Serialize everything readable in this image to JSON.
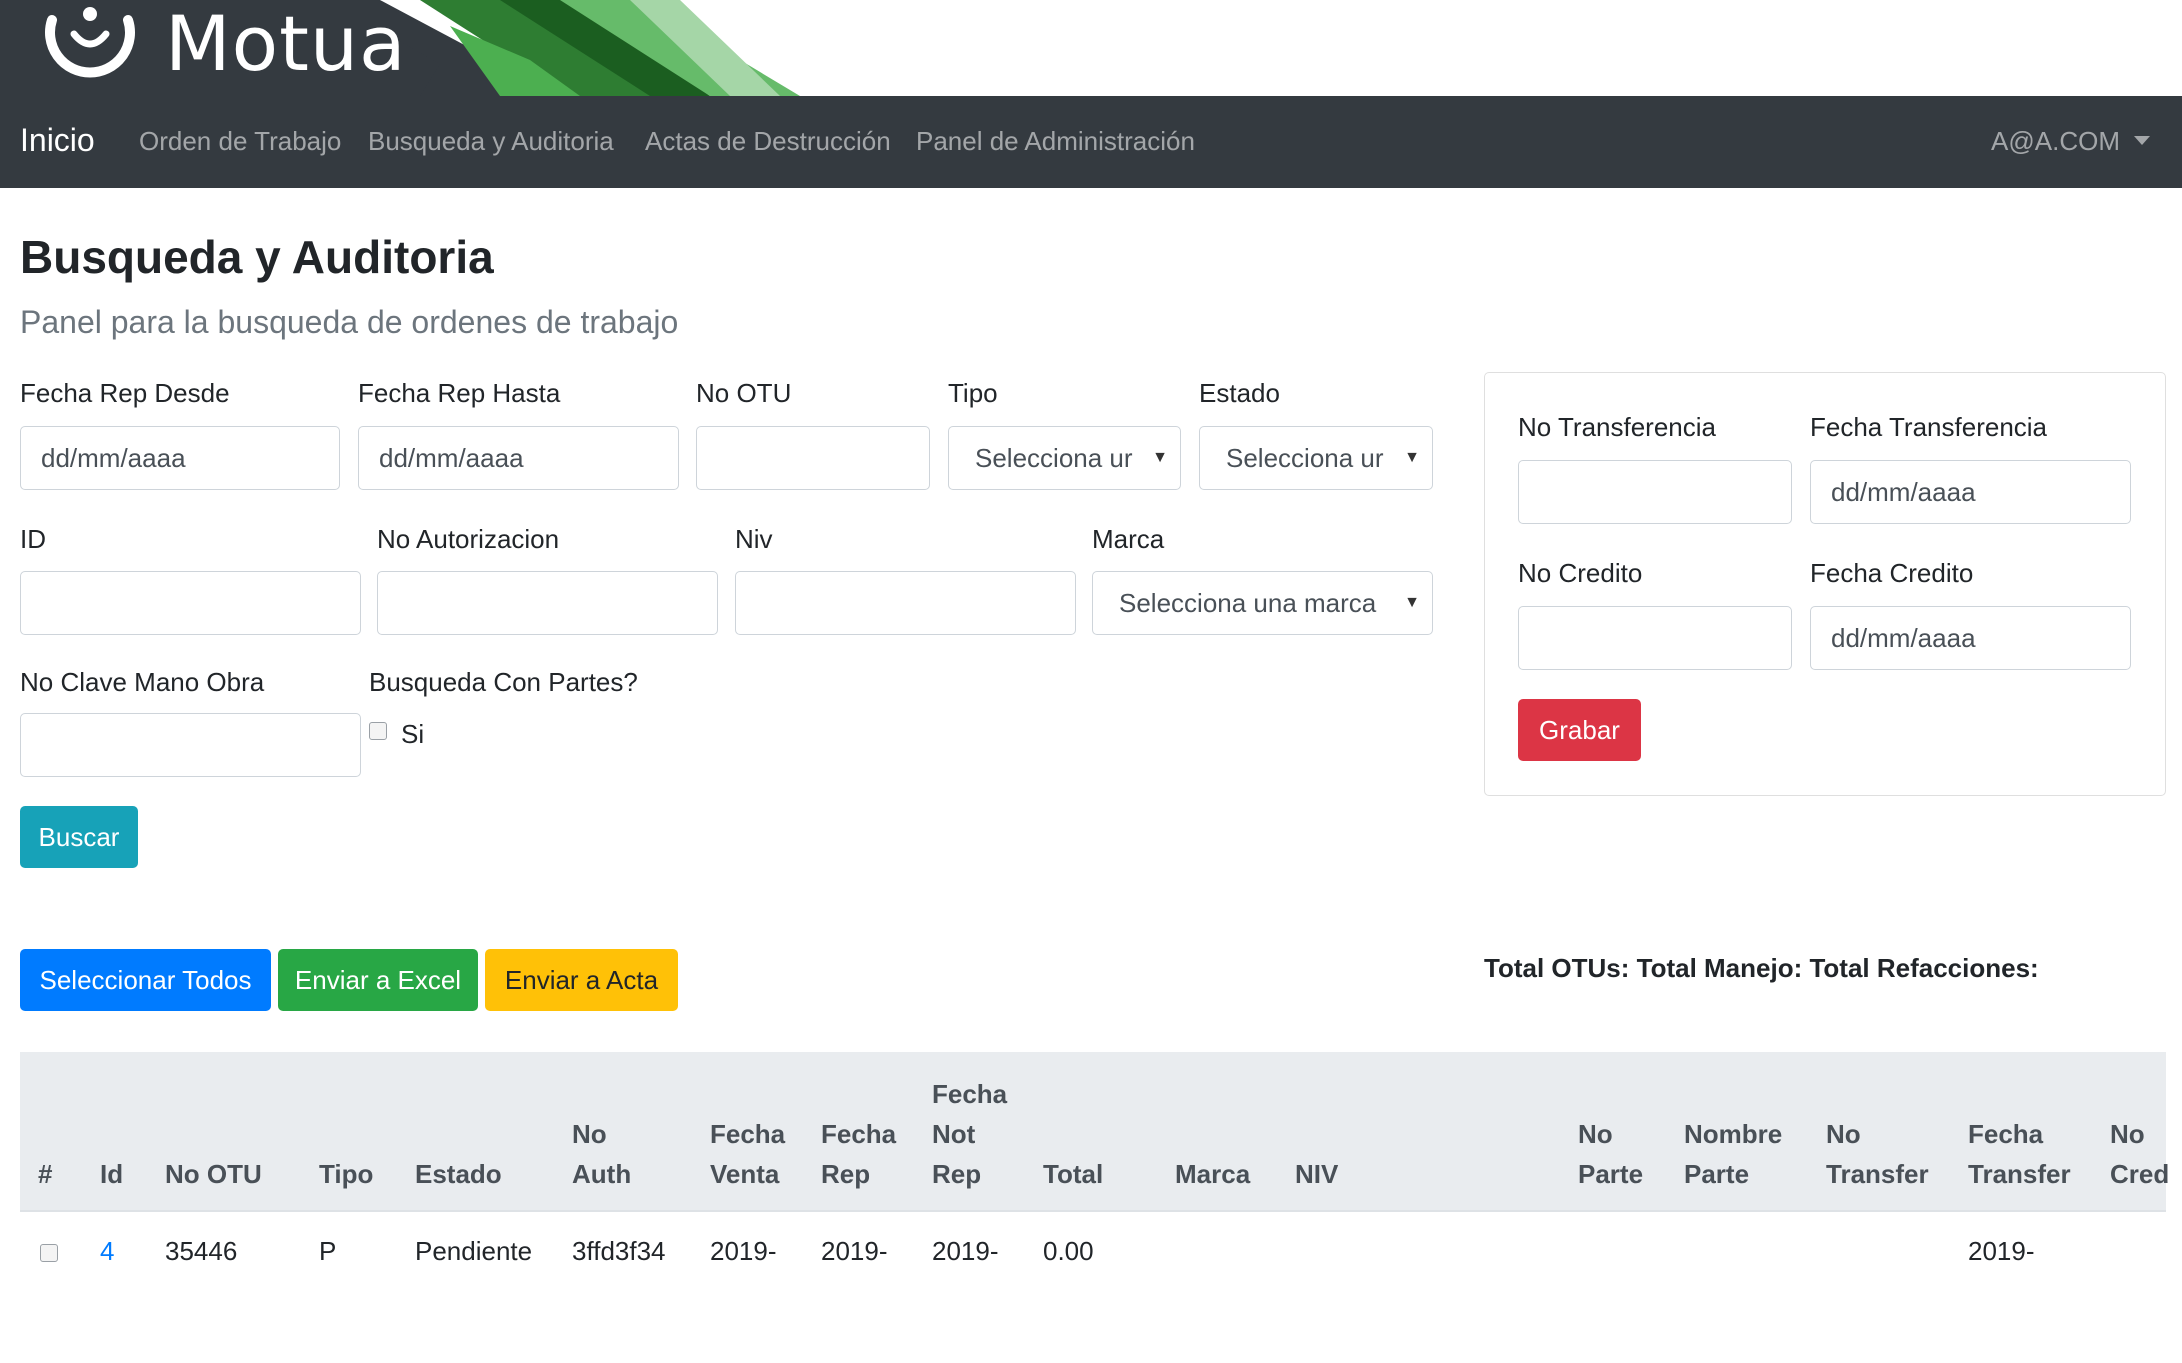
{
  "app": {
    "logo_text": "Motua"
  },
  "nav": {
    "brand": "Inicio",
    "items": [
      {
        "label": "Orden de Trabajo"
      },
      {
        "label": "Busqueda y Auditoria"
      },
      {
        "label": "Actas de Destrucción"
      },
      {
        "label": "Panel de Administración"
      }
    ],
    "user": "A@A.COM"
  },
  "page": {
    "title": "Busqueda y Auditoria",
    "subtitle": "Panel para la busqueda de ordenes de trabajo"
  },
  "search_form": {
    "fecha_desde": {
      "label": "Fecha Rep Desde",
      "value": "dd/mm/aaaa"
    },
    "fecha_hasta": {
      "label": "Fecha Rep Hasta",
      "value": "dd/mm/aaaa"
    },
    "no_otu": {
      "label": "No OTU",
      "value": ""
    },
    "tipo": {
      "label": "Tipo",
      "selected": "Selecciona ur"
    },
    "estado": {
      "label": "Estado",
      "selected": "Selecciona ur"
    },
    "id": {
      "label": "ID",
      "value": ""
    },
    "no_autorizacion": {
      "label": "No Autorizacion",
      "value": ""
    },
    "niv": {
      "label": "Niv",
      "value": ""
    },
    "marca": {
      "label": "Marca",
      "selected": "Selecciona una marca"
    },
    "no_clave": {
      "label": "No Clave Mano Obra",
      "value": ""
    },
    "con_partes": {
      "label": "Busqueda Con Partes?",
      "option": "Si",
      "checked": false
    },
    "buscar_label": "Buscar"
  },
  "transfer_card": {
    "no_transferencia": {
      "label": "No Transferencia",
      "value": ""
    },
    "fecha_transferencia": {
      "label": "Fecha Transferencia",
      "value": "dd/mm/aaaa"
    },
    "no_credito": {
      "label": "No Credito",
      "value": ""
    },
    "fecha_credito": {
      "label": "Fecha Credito",
      "value": "dd/mm/aaaa"
    },
    "grabar_label": "Grabar"
  },
  "actions": {
    "select_all": "Seleccionar Todos",
    "excel": "Enviar a Excel",
    "acta": "Enviar a Acta"
  },
  "totals": "Total OTUs: Total Manejo: Total Refacciones:",
  "table": {
    "headers": [
      [
        "#"
      ],
      [
        "Id"
      ],
      [
        "No OTU"
      ],
      [
        "Tipo"
      ],
      [
        "Estado"
      ],
      [
        "No",
        "Auth"
      ],
      [
        "Fecha",
        "Venta"
      ],
      [
        "Fecha",
        "Rep"
      ],
      [
        "Fecha",
        "Not",
        "Rep"
      ],
      [
        "Total"
      ],
      [
        "Marca"
      ],
      [
        "NIV"
      ],
      [
        "No",
        "Parte"
      ],
      [
        "Nombre",
        "Parte"
      ],
      [
        "No",
        "Transfer"
      ],
      [
        "Fecha",
        "Transfer"
      ],
      [
        "No",
        "Cred"
      ]
    ],
    "rows": [
      {
        "id": "4",
        "no_otu": "35446",
        "tipo": "P",
        "estado": "Pendiente",
        "no_auth": "3ffd3f34",
        "fecha_venta": "2019-",
        "fecha_rep": "2019-",
        "fecha_not_rep": "2019-",
        "total": "0.00",
        "fecha_transfer": "2019-"
      }
    ]
  },
  "colors": {
    "navbar": "#343a40",
    "info": "#17a2b8",
    "primary": "#007bff",
    "success": "#28a745",
    "warning": "#ffc107",
    "danger": "#dc3545"
  }
}
